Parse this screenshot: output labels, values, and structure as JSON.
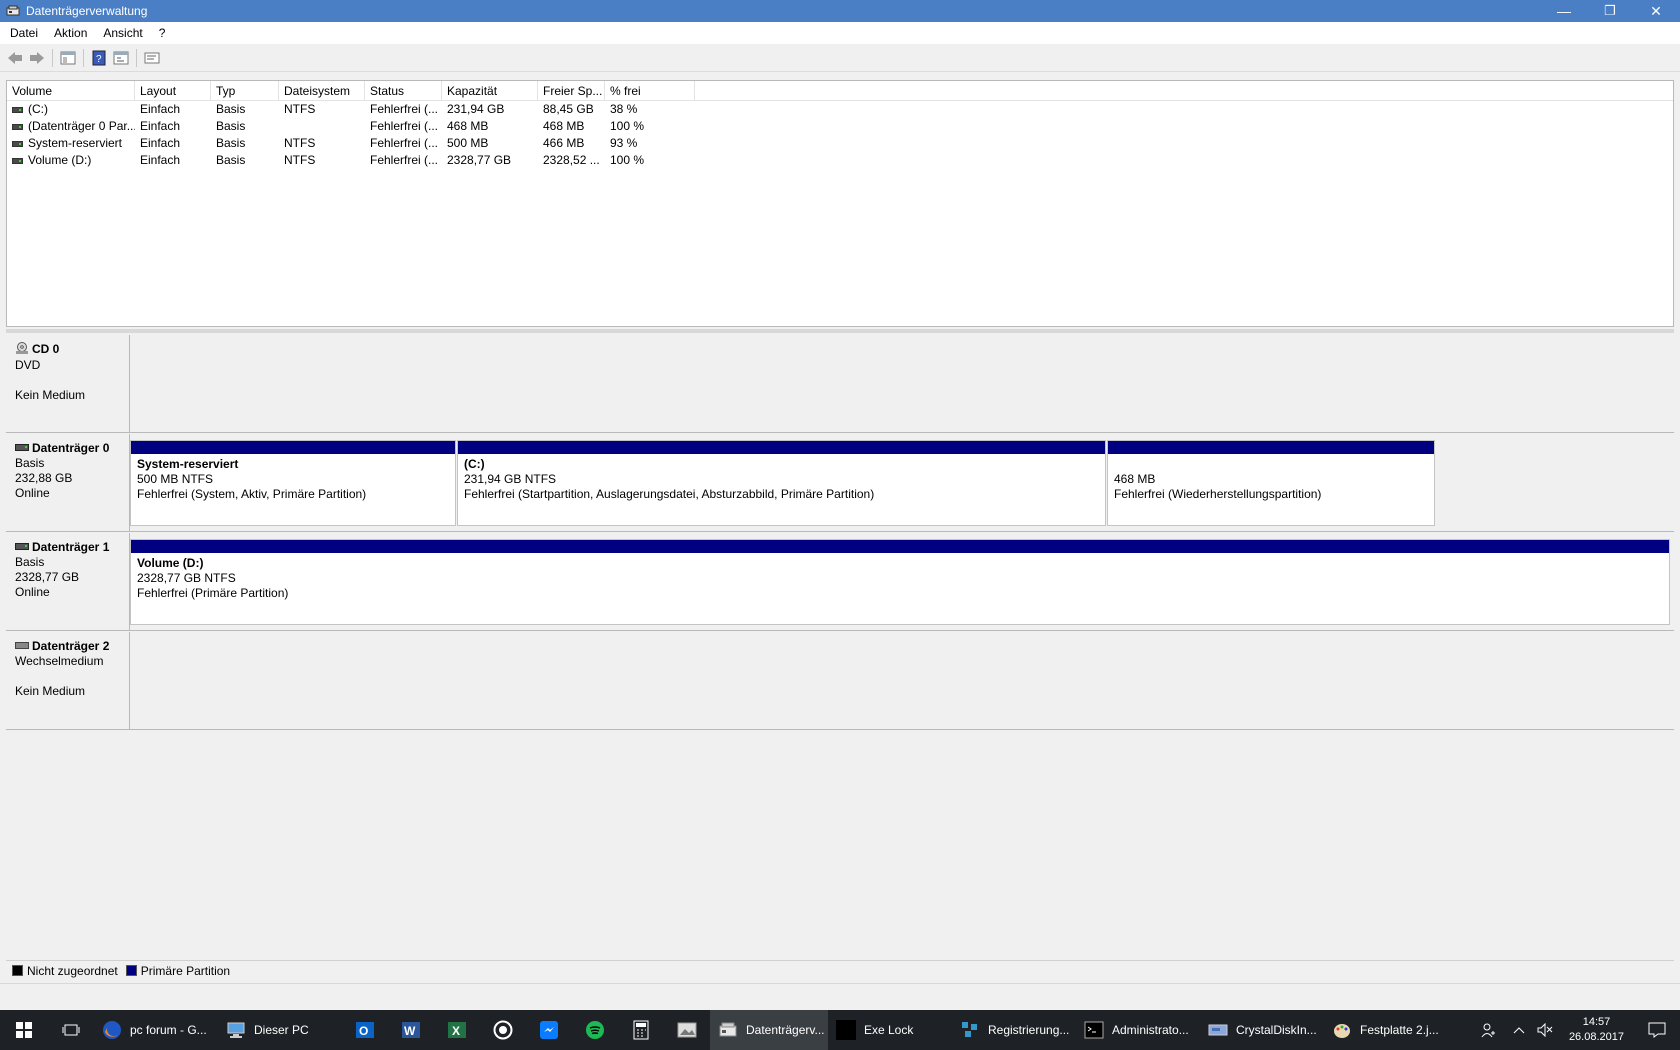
{
  "window": {
    "title": "Datenträgerverwaltung",
    "minimize_label": "—",
    "restore_label": "❐",
    "close_label": "✕"
  },
  "menu": [
    "Datei",
    "Aktion",
    "Ansicht",
    "?"
  ],
  "volume_list": {
    "columns": [
      "Volume",
      "Layout",
      "Typ",
      "Dateisystem",
      "Status",
      "Kapazität",
      "Freier Sp...",
      "% frei"
    ],
    "rows": [
      {
        "volume": "(C:)",
        "layout": "Einfach",
        "typ": "Basis",
        "fs": "NTFS",
        "status": "Fehlerfrei (...",
        "cap": "231,94 GB",
        "free": "88,45 GB",
        "pct": "38 %"
      },
      {
        "volume": "(Datenträger 0 Par...",
        "layout": "Einfach",
        "typ": "Basis",
        "fs": "",
        "status": "Fehlerfrei (...",
        "cap": "468 MB",
        "free": "468 MB",
        "pct": "100 %"
      },
      {
        "volume": "System-reserviert",
        "layout": "Einfach",
        "typ": "Basis",
        "fs": "NTFS",
        "status": "Fehlerfrei (...",
        "cap": "500 MB",
        "free": "466 MB",
        "pct": "93 %"
      },
      {
        "volume": "Volume (D:)",
        "layout": "Einfach",
        "typ": "Basis",
        "fs": "NTFS",
        "status": "Fehlerfrei (...",
        "cap": "2328,77 GB",
        "free": "2328,52 ...",
        "pct": "100 %"
      }
    ]
  },
  "disks": {
    "cd0": {
      "name": "CD 0",
      "type": "DVD",
      "state": "Kein Medium"
    },
    "disk0": {
      "name": "Datenträger 0",
      "type": "Basis",
      "size": "232,88 GB",
      "state": "Online",
      "partitions": [
        {
          "title": "System-reserviert",
          "size": "500 MB NTFS",
          "status": "Fehlerfrei (System, Aktiv, Primäre Partition)"
        },
        {
          "title": "(C:)",
          "size": "231,94 GB NTFS",
          "status": "Fehlerfrei (Startpartition, Auslagerungsdatei, Absturzabbild, Primäre Partition)"
        },
        {
          "title": "",
          "size": "468 MB",
          "status": "Fehlerfrei (Wiederherstellungspartition)"
        }
      ]
    },
    "disk1": {
      "name": "Datenträger 1",
      "type": "Basis",
      "size": "2328,77 GB",
      "state": "Online",
      "partitions": [
        {
          "title": "Volume  (D:)",
          "size": "2328,77 GB NTFS",
          "status": "Fehlerfrei (Primäre Partition)"
        }
      ]
    },
    "disk2": {
      "name": "Datenträger 2",
      "type": "Wechselmedium",
      "state": "Kein Medium"
    }
  },
  "legend": {
    "unallocated": "Nicht zugeordnet",
    "primary": "Primäre Partition",
    "unallocated_color": "#000000",
    "primary_color": "#000080"
  },
  "taskbar": {
    "items": [
      "pc forum - G...",
      "Dieser PC",
      "Datenträgerv...",
      "Exe Lock",
      "Registrierung...",
      "Administrato...",
      "CrystalDiskIn...",
      "Festplatte 2.j..."
    ],
    "time": "14:57",
    "date": "26.08.2017"
  }
}
